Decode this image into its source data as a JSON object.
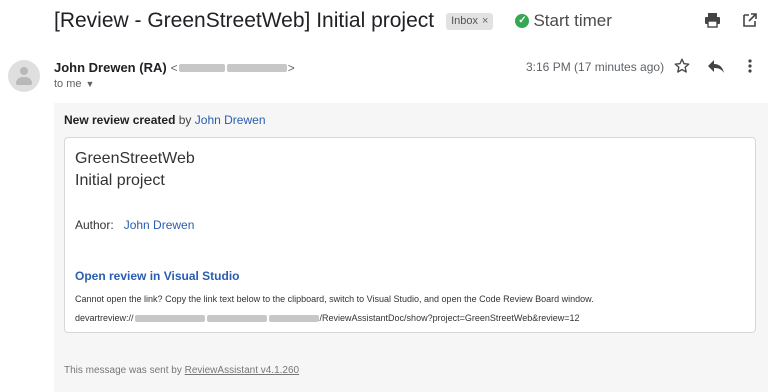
{
  "header": {
    "subject": "[Review - GreenStreetWeb] Initial project",
    "inbox_label": "Inbox",
    "inbox_remove": "×",
    "timer_label": "Start timer",
    "icons": [
      "print-icon",
      "open-new-window-icon"
    ]
  },
  "message": {
    "sender_name": "John Drewen (RA)",
    "sender_email_open": "<",
    "sender_email_close": ">",
    "to_label": "to me",
    "timestamp": "3:16 PM (17 minutes ago)",
    "icons": [
      "star-icon",
      "reply-icon",
      "more-vert-icon"
    ]
  },
  "body": {
    "created_bold": "New review created",
    "created_by": "by",
    "created_author": "John Drewen",
    "project_name": "GreenStreetWeb",
    "project_description": "Initial project",
    "author_label": "Author:",
    "author_name": "John Drewen",
    "open_link": "Open review in Visual Studio",
    "hint": "Cannot open the link? Copy the link text below to the clipboard, switch to Visual Studio, and open the Code Review Board window.",
    "url_prefix": "devartreview://",
    "url_suffix": "/ReviewAssistantDoc/show?project=GreenStreetWeb&review=12"
  },
  "footer": {
    "text": "This message was sent by",
    "link": "ReviewAssistant v4.1.260"
  },
  "colors": {
    "link": "#2a5db0",
    "timer_green": "#34a853",
    "background_panel": "#f6f6f6"
  }
}
